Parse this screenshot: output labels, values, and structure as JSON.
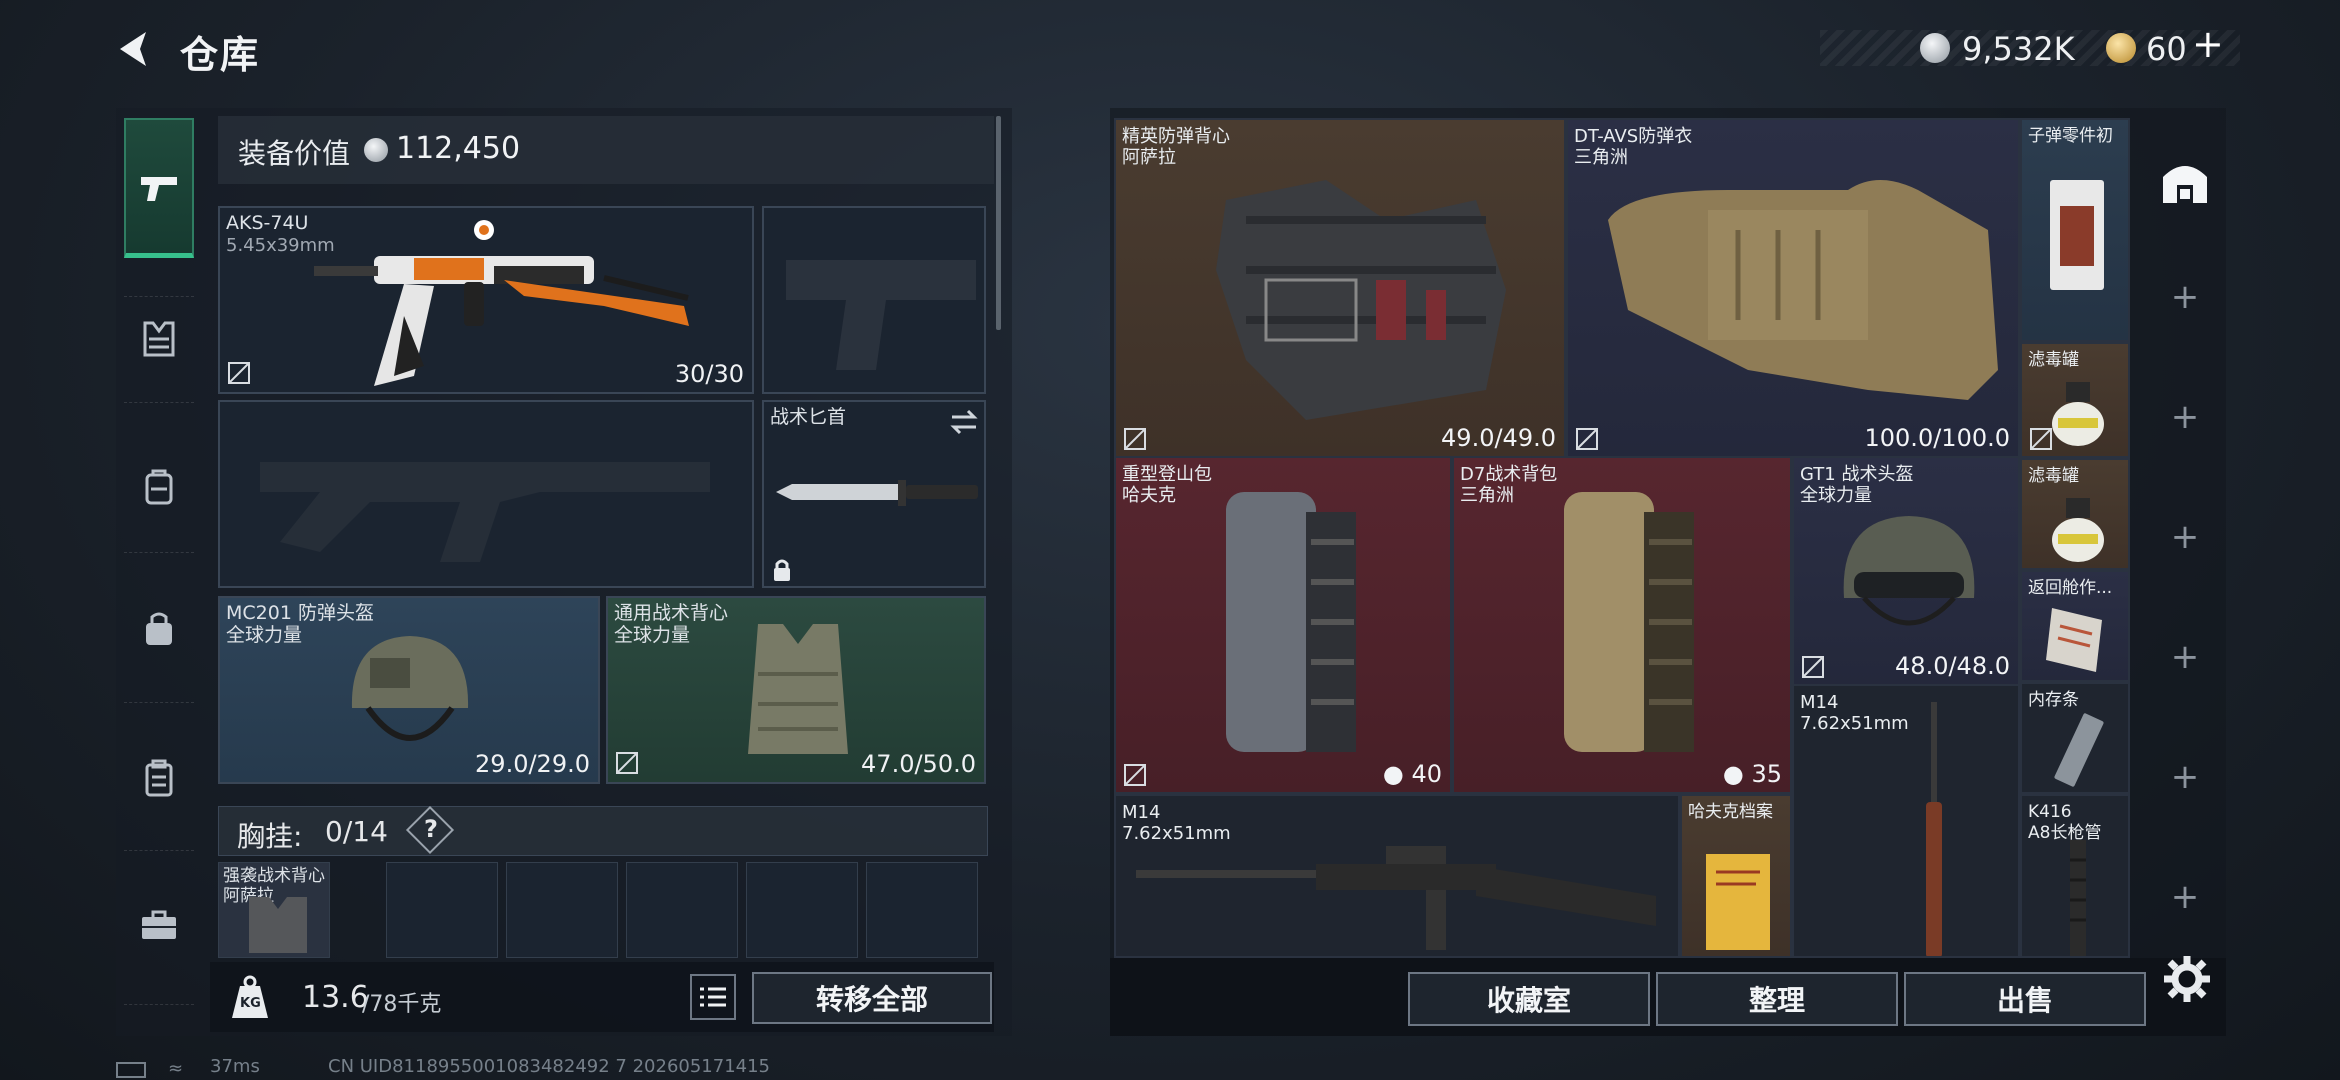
{
  "header": {
    "title": "仓库",
    "currency1": "9,532K",
    "currency2": "60"
  },
  "sidebar": {
    "items": [
      "weapon",
      "chest-rig",
      "backpack",
      "bag",
      "container",
      "briefcase"
    ]
  },
  "loadout": {
    "value_label": "装备价值",
    "value": "112,450",
    "primary": {
      "name": "AKS-74U",
      "ammo": "5.45x39mm",
      "count": "30/30"
    },
    "knife": {
      "name": "战术匕首"
    },
    "helmet": {
      "name": "MC201 防弹头盔",
      "brand": "全球力量",
      "durability": "29.0/29.0"
    },
    "vest": {
      "name": "通用战术背心",
      "brand": "全球力量",
      "durability": "47.0/50.0"
    },
    "chest_rig": {
      "label": "胸挂:",
      "count": "0/14",
      "help": "?"
    },
    "rig_item": {
      "name": "强袭战术背心",
      "brand": "阿萨拉"
    },
    "weight": "13.6",
    "weight_max": "/78千克",
    "transfer_all": "转移全部",
    "kg_icon_text": "KG"
  },
  "stash": {
    "items": [
      {
        "name": "精英防弹背心",
        "brand": "阿萨拉",
        "value": "49.0/49.0"
      },
      {
        "name": "DT-AVS防弹衣",
        "brand": "三角洲",
        "value": "100.0/100.0"
      },
      {
        "name": "子弹零件初"
      },
      {
        "name": "滤毒罐"
      },
      {
        "name": "重型登山包",
        "brand": "哈夫克",
        "value": "40"
      },
      {
        "name": "D7战术背包",
        "brand": "三角洲",
        "value": "35"
      },
      {
        "name": "GT1 战术头盔",
        "brand": "全球力量",
        "value": "48.0/48.0"
      },
      {
        "name": "滤毒罐"
      },
      {
        "name": "返回舱作..."
      },
      {
        "name": "M14",
        "brand": "7.62x51mm"
      },
      {
        "name": "内存条"
      },
      {
        "name": "M14",
        "brand": "7.62x51mm"
      },
      {
        "name": "哈夫克档案"
      },
      {
        "name": "K416",
        "brand": "A8长枪管"
      }
    ],
    "buttons": {
      "collection": "收藏室",
      "sort": "整理",
      "sell": "出售"
    }
  },
  "status": {
    "ping": "37ms",
    "uid": "CN UID8118955001083482492 7 202605171415"
  },
  "colors": {
    "active_tab": "#37c08c",
    "red_cell": "#57262f",
    "brown_cell": "#4a3c30"
  }
}
